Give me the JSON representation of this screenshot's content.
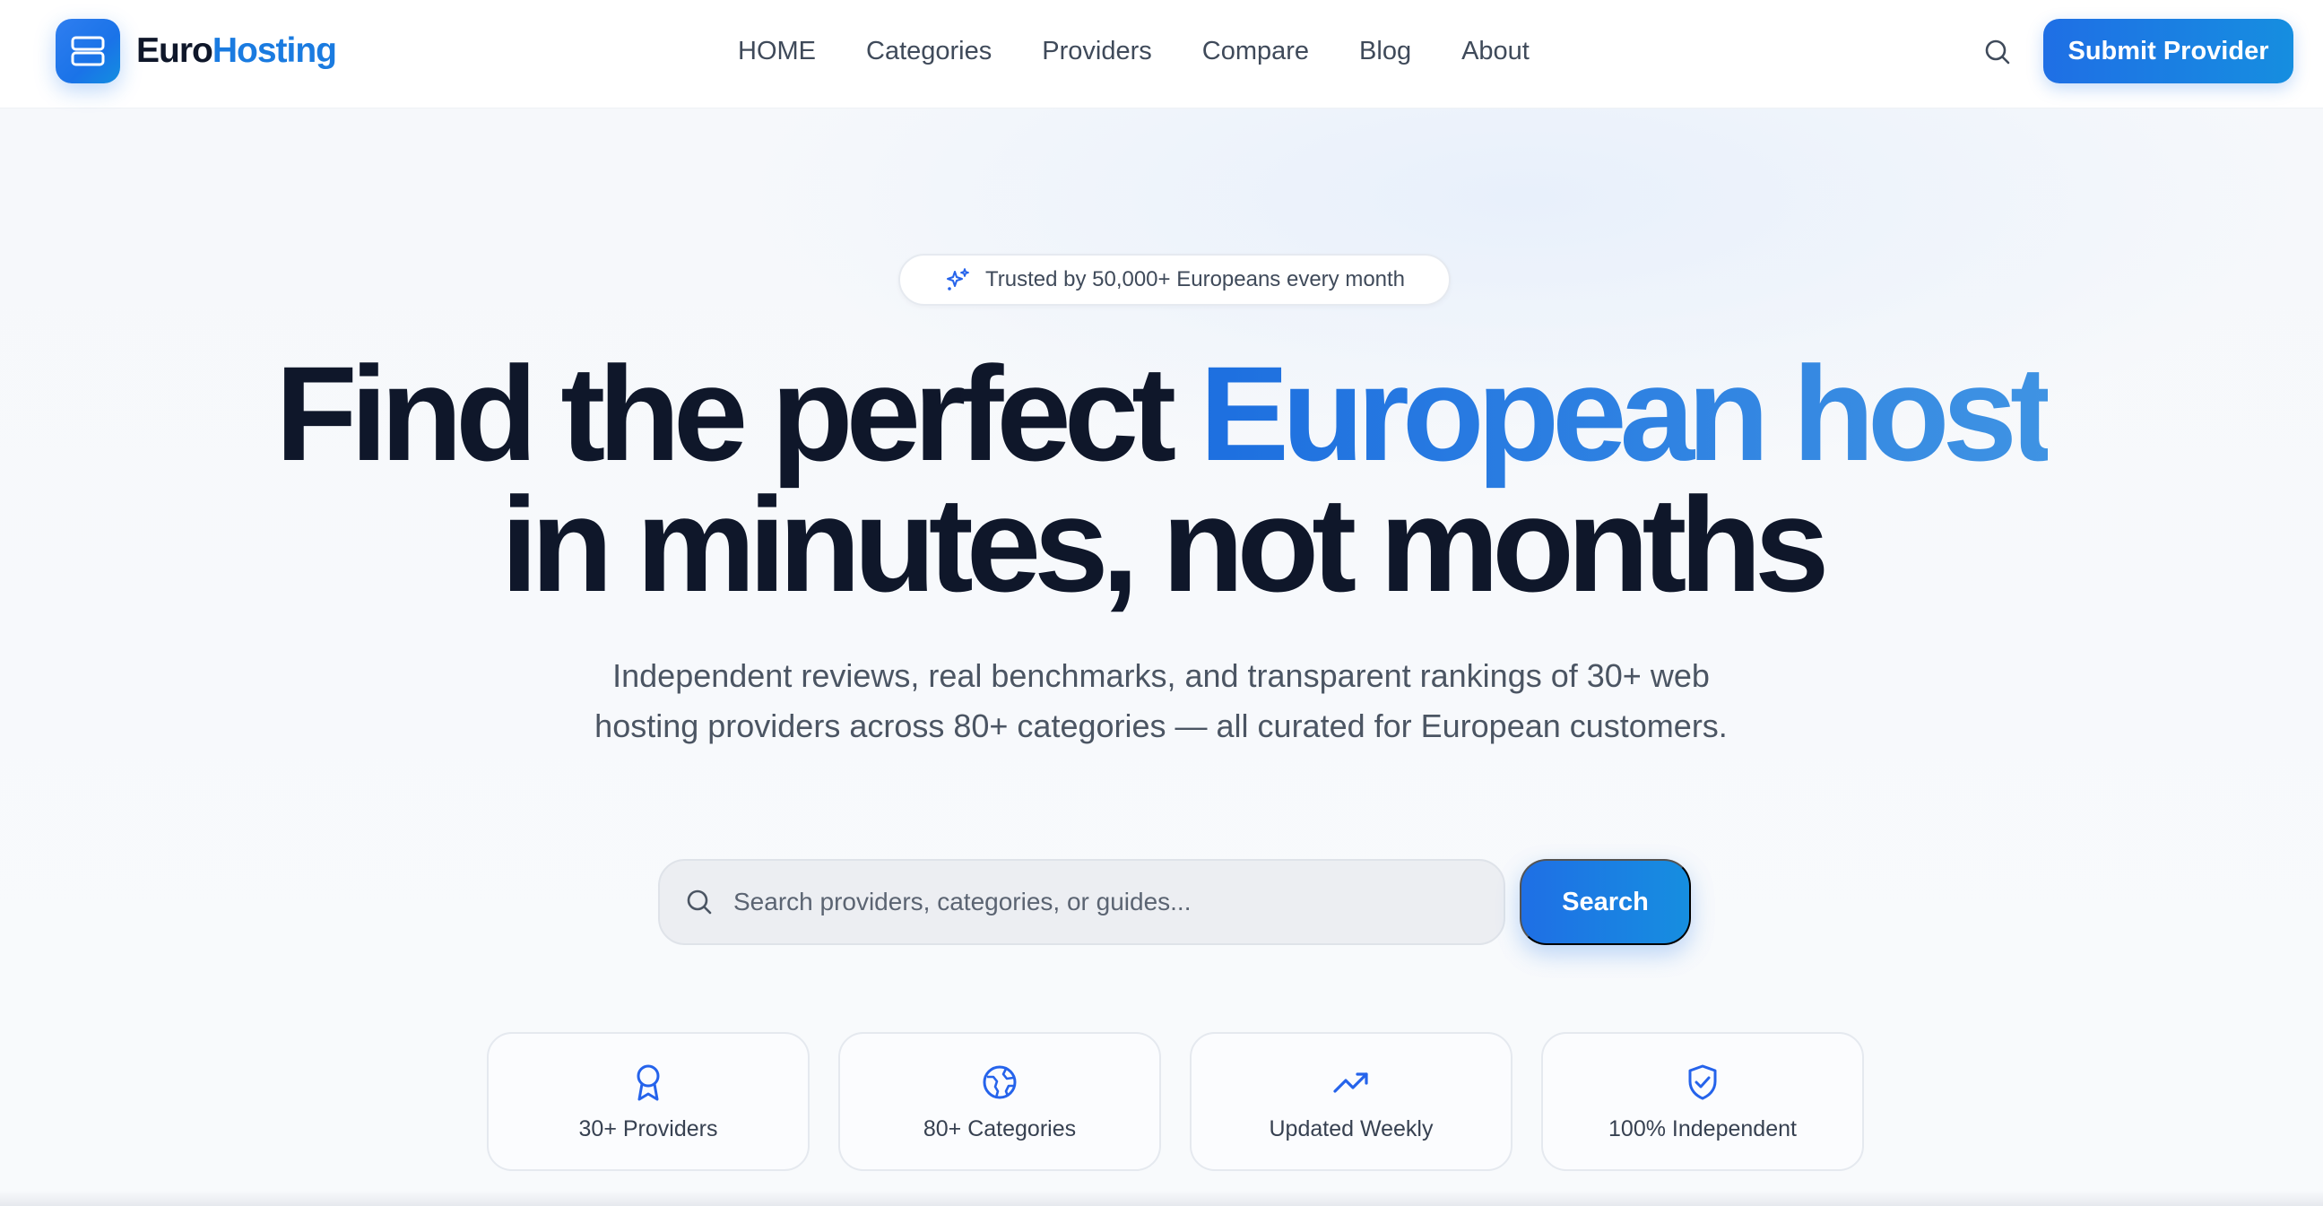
{
  "brand": {
    "name_part1": "Euro",
    "name_part2": "Hosting",
    "accent_color": "#1a7be0"
  },
  "nav": {
    "items": [
      {
        "label": "HOME"
      },
      {
        "label": "Categories"
      },
      {
        "label": "Providers"
      },
      {
        "label": "Compare"
      },
      {
        "label": "Blog"
      },
      {
        "label": "About"
      }
    ]
  },
  "header": {
    "search_icon": "search-icon",
    "submit_label": "Submit Provider"
  },
  "hero": {
    "trust_badge": "Trusted by 50,000+ Europeans every month",
    "headline_plain": "Find the perfect",
    "headline_accent": "European host",
    "headline_line2": "in minutes, not months",
    "subtitle": "Independent reviews, real benchmarks, and transparent rankings of 30+ web hosting providers across 80+ categories — all curated for European customers.",
    "search_placeholder": "Search providers, categories, or guides...",
    "search_button": "Search"
  },
  "stats": [
    {
      "icon": "award-icon",
      "label": "30+ Providers"
    },
    {
      "icon": "globe-icon",
      "label": "80+ Categories"
    },
    {
      "icon": "trending-up-icon",
      "label": "Updated Weekly"
    },
    {
      "icon": "shield-check-icon",
      "label": "100% Independent"
    }
  ],
  "colors": {
    "primary": "#1f6fe5",
    "text_dark": "#0f172a",
    "muted": "#4b5563"
  }
}
